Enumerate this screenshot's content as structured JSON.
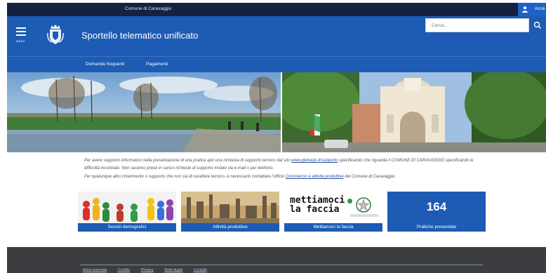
{
  "topbar": {
    "municipality": "Comune di Caravaggio",
    "access_label": "Acce"
  },
  "header": {
    "menu_label": "MENU",
    "title": "Sportello telematico unificato",
    "search_placeholder": "Cerca..."
  },
  "nav": {
    "items": [
      "Domande frequenti",
      "Pagamenti"
    ]
  },
  "info": {
    "p1_a": "Per avere supporto informatico nella presentazione di una pratica apri una richiesta di supporto tecnico dal sito ",
    "p1_link": "www.globogis.it/supporto",
    "p1_b": " specificando che riguarda il COMUNE DI CARAVAGGIO specificando le difficoltà incontrate. Non saranno prese in carico richieste di supporto inviate via e-mail o per telefono.",
    "p2_a": "Per qualunque altro chiarimento o supporto che non sia di carattere tecnico, è necessario contattare l'ufficio ",
    "p2_link": "Commercio e attività produttive",
    "p2_b": " del Comune di Caravaggio."
  },
  "tiles": [
    {
      "caption": "Servizi demografici"
    },
    {
      "caption": "Attività produttive"
    },
    {
      "caption": "Mettiamoci la faccia",
      "logo_line1": "mettiamoci",
      "logo_line2": "la faccia"
    },
    {
      "caption": "Pratiche presentate",
      "count": "164"
    }
  ],
  "footer": {
    "links": [
      "Area riservata",
      "Credits",
      "Privacy",
      "Note legali",
      "Contatti"
    ]
  },
  "colors": {
    "primary": "#1d5bb4",
    "topbar": "#14213f",
    "footer": "#3b3d41"
  }
}
